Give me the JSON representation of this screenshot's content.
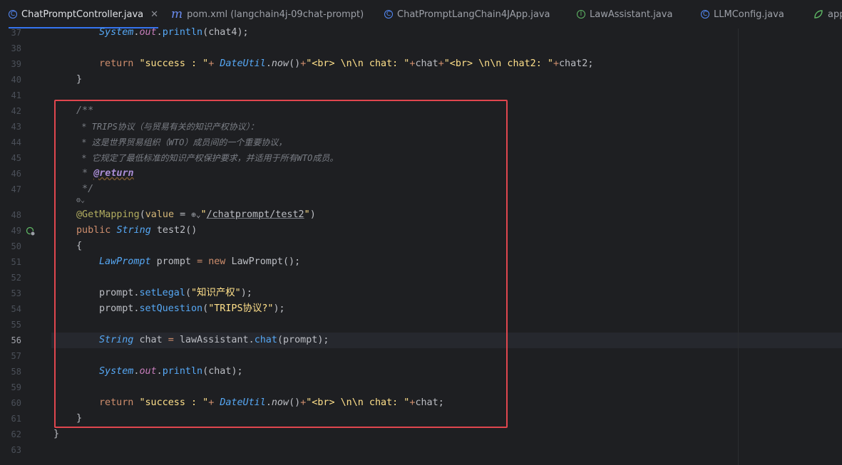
{
  "tabs": [
    {
      "label": "ChatPromptController.java",
      "icon": "class-icon",
      "active": true
    },
    {
      "label": "pom.xml (langchain4j-09chat-prompt)",
      "icon": "maven-icon"
    },
    {
      "label": "ChatPromptLangChain4JApp.java",
      "icon": "springboot-class-icon"
    },
    {
      "label": "LawAssistant.java",
      "icon": "interface-icon"
    },
    {
      "label": "LLMConfig.java",
      "icon": "class-icon"
    },
    {
      "label": "app",
      "icon": "properties-icon"
    }
  ],
  "editor": {
    "line_numbers": [
      "37",
      "38",
      "39",
      "40",
      "41",
      "42",
      "43",
      "44",
      "45",
      "46",
      "47",
      "48",
      "49",
      "50",
      "51",
      "52",
      "53",
      "54",
      "55",
      "56",
      "57",
      "58",
      "59",
      "60",
      "61",
      "62",
      "63"
    ],
    "current_line": "56",
    "colors": {
      "highlight_box": "#e0464e",
      "background": "#1e1f22"
    },
    "code": {
      "l37_obj": "System",
      "l37_out": "out",
      "l37_m": "println",
      "l37_arg": "chat4",
      "l39_ret": "return",
      "l39_s1": "\"success : \"",
      "l39_cls": "DateUtil",
      "l39_now": "now",
      "l39_s2": "\"<br> \\n\\n chat: \"",
      "l39_v1": "chat",
      "l39_s3": "\"<br> \\n\\n chat2: \"",
      "l39_v2": "chat2",
      "l42": "/**",
      "l43": " * TRIPS协议（与贸易有关的知识产权协议）：",
      "l44": " * 这是世界贸易组织（WTO）成员间的一个重要协议，",
      "l45": " * 它规定了最低标准的知识产权保护要求，并适用于所有WTO成员。",
      "l46_star": " * ",
      "l46_tag": "@return",
      "l47": " */",
      "l48_anno": "@GetMapping",
      "l48_attr": "value",
      "l48_url": "/chatprompt/test2",
      "l49_kw": "public",
      "l49_type": "String",
      "l49_name": "test2",
      "l50": "{",
      "l51_type": "LawPrompt",
      "l51_var": "prompt",
      "l51_new": "new",
      "l51_ctor": "LawPrompt",
      "l53_var": "prompt",
      "l53_m": "setLegal",
      "l53_str": "\"知识产权\"",
      "l54_var": "prompt",
      "l54_m": "setQuestion",
      "l54_str": "\"TRIPS协议?\"",
      "l56_type": "String",
      "l56_var": "chat",
      "l56_obj": "lawAssistant",
      "l56_m": "chat",
      "l56_arg": "prompt",
      "l58_obj": "System",
      "l58_out": "out",
      "l58_m": "println",
      "l58_arg": "chat",
      "l60_ret": "return",
      "l60_s1": "\"success : \"",
      "l60_cls": "DateUtil",
      "l60_now": "now",
      "l60_s2": "\"<br> \\n\\n chat: \"",
      "l60_v": "chat",
      "l61": "}",
      "l62": "}"
    }
  }
}
